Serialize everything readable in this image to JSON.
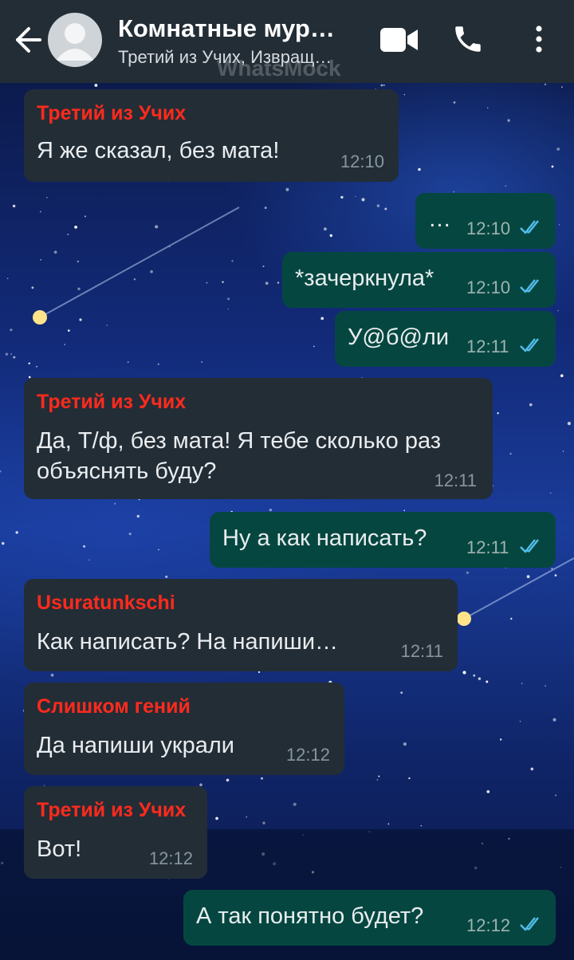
{
  "header": {
    "title": "Комнатные мур…",
    "subtitle": "Третий из Учих, Извращ…",
    "watermark": "WhatsMock"
  },
  "messages": [
    {
      "dir": "in",
      "sender": "Третий из Учих",
      "text": "Я же сказал, без мата!",
      "time": "12:10"
    },
    {
      "dir": "out",
      "text": "…",
      "time": "12:10",
      "status": "read"
    },
    {
      "dir": "out",
      "text": "*зачеркнула*",
      "time": "12:10",
      "status": "read"
    },
    {
      "dir": "out",
      "text": "У@б@ли",
      "time": "12:11",
      "status": "read"
    },
    {
      "dir": "in",
      "sender": "Третий из Учих",
      "text1": "Да, Т/ф, без мата! Я тебе сколько раз",
      "text2": "объяснять буду?",
      "time": "12:11"
    },
    {
      "dir": "out",
      "text": "Ну а как написать?",
      "time": "12:11",
      "status": "read"
    },
    {
      "dir": "in",
      "sender": "Usuratunkschi",
      "text": "Как написать? На напиши…",
      "time": "12:11"
    },
    {
      "dir": "in",
      "sender": "Слишком гений",
      "text": "Да напиши украли",
      "time": "12:12"
    },
    {
      "dir": "in",
      "sender": "Третий из Учих",
      "text": "Вот!",
      "time": "12:12"
    },
    {
      "dir": "out",
      "text": "А так понятно будет?",
      "time": "12:12",
      "status": "read"
    }
  ],
  "colors": {
    "header_bg": "#232d36",
    "incoming_bg": "#232d36",
    "outgoing_bg": "#054740",
    "sender_name": "#ff2a1c",
    "read_ticks": "#53bdeb"
  },
  "icons": [
    "back-arrow-icon",
    "video-call-icon",
    "phone-icon",
    "more-options-icon",
    "double-check-icon"
  ]
}
